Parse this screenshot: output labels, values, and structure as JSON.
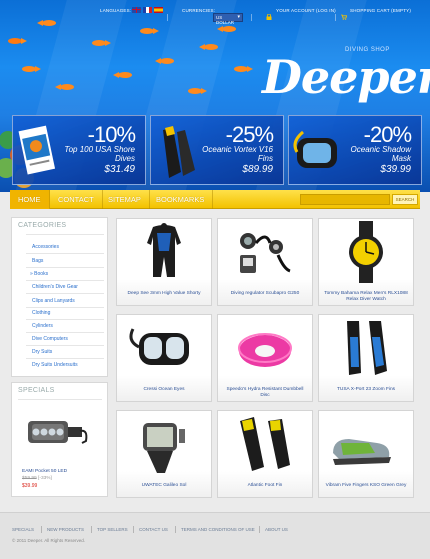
{
  "topbar": {
    "languages_label": "LANGUAGES:",
    "currencies_label": "CURRENCIES:",
    "currency_value": "US Dollar",
    "account_label": "YOUR ACCOUNT (LOG IN)",
    "cart_label": "SHOPPING CART (EMPTY)"
  },
  "brand": {
    "tagline": "DIVING SHOP",
    "logo": "Deeper"
  },
  "banners": [
    {
      "pct": "-10%",
      "desc": "Top 100 USA Shore Dives",
      "price": "$31.49"
    },
    {
      "pct": "-25%",
      "desc": "Oceanic Vortex V16 Fins",
      "price": "$89.99"
    },
    {
      "pct": "-20%",
      "desc": "Oceanic Shadow Mask",
      "price": "$39.99"
    }
  ],
  "nav": {
    "items": [
      "HOME",
      "CONTACT",
      "SITEMAP",
      "BOOKMARKS"
    ],
    "search_button": "SEARCH"
  },
  "categories": {
    "title": "CATEGORIES",
    "items": [
      "Accessories",
      "Bags",
      "Books",
      "Children's Dive Gear",
      "Clips and Lanyards",
      "Clothing",
      "Cylinders",
      "Dive Computers",
      "Dry Suits",
      "Dry Suits Undersuits"
    ],
    "selected": "Books"
  },
  "specials": {
    "title": "SPECIALS",
    "name": "EAMI Pocket 50 LED",
    "old_price": "$59.99",
    "discount": "[-33%]",
    "new_price": "$39.99"
  },
  "products": [
    {
      "name": "Deep See 3mm High Value Shorty"
    },
    {
      "name": "Diving regulator Scubapro G250"
    },
    {
      "name": "Tommy Bahama Relax Men's RLX1088 Relax Diver Watch"
    },
    {
      "name": "Cressi Ocean Eyes"
    },
    {
      "name": "Speedo's Hydra Resistant Dumbbell Disc"
    },
    {
      "name": "TUSA X-Port 23 Zoom Fins"
    },
    {
      "name": "UWATEC Galileo Sol"
    },
    {
      "name": "Atlantic Foot Fin"
    },
    {
      "name": "Vibram Five Fingers KSO Green Grey"
    }
  ],
  "footer": {
    "links": [
      "SPECIALS",
      "NEW PRODUCTS",
      "TOP SELLERS",
      "CONTACT US",
      "TERMS AND CONDITIONS OF USE",
      "ABOUT US"
    ],
    "copyright": "© 2011 Deeper. All Rights Reserved."
  },
  "colors": {
    "accent_yellow": "#f3c200",
    "header_blue": "#1b8cf0",
    "link_blue": "#2a6fcc",
    "price_red": "#d9261c"
  }
}
